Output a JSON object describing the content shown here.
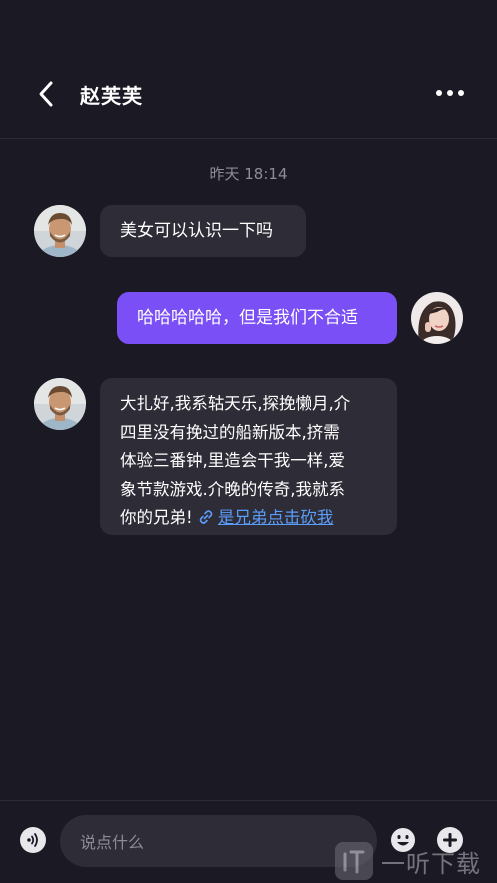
{
  "header": {
    "title": "赵芙芙"
  },
  "conversation": {
    "timestamp": "昨天 18:14",
    "messages": [
      {
        "direction": "incoming",
        "text": "美女可以认识一下吗"
      },
      {
        "direction": "outgoing",
        "text": "哈哈哈哈哈，但是我们不合适"
      },
      {
        "direction": "incoming",
        "lines": [
          "大扎好,我系轱天乐,探挽懒月,介",
          "四里没有挽过的船新版本,挤需",
          "体验三番钟,里造会干我一样,爱",
          "象节款游戏.介晚的传奇,我就系"
        ],
        "last_line_prefix": "你的兄弟!",
        "link_text": "是兄弟点击砍我"
      }
    ]
  },
  "composer": {
    "placeholder": "说点什么"
  },
  "watermark": {
    "text": "一听下载"
  },
  "colors": {
    "background": "#1b1a24",
    "bubble_incoming": "#2d2c37",
    "bubble_outgoing": "#7a4ff5",
    "link": "#5b9dfa"
  }
}
